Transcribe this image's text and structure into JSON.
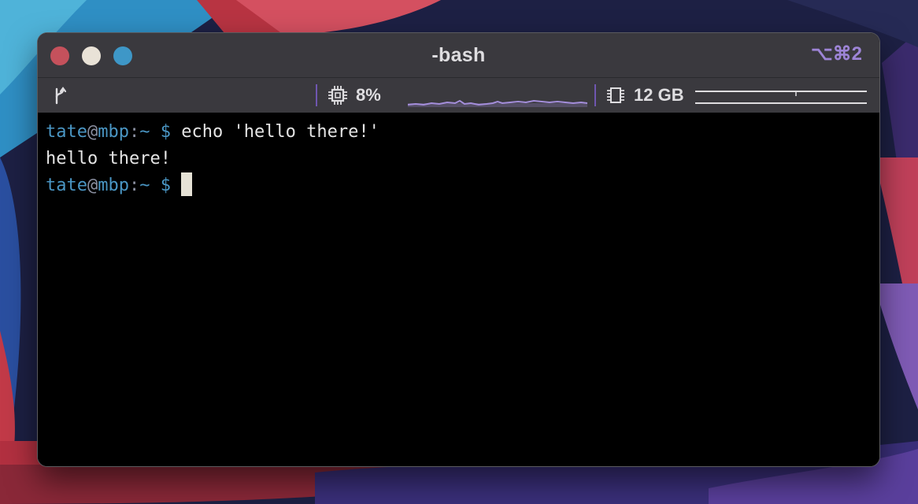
{
  "window": {
    "title": "-bash",
    "shortcut": "⌥⌘2"
  },
  "status": {
    "cpu_percent": "8%",
    "memory": "12 GB"
  },
  "terminal": {
    "lines": [
      {
        "user": "tate",
        "at": "@",
        "host": "mbp",
        "colon": ":",
        "cwd": "~",
        "dollar": "$",
        "command": " echo 'hello there!'"
      },
      {
        "output": "hello there!"
      },
      {
        "user": "tate",
        "at": "@",
        "host": "mbp",
        "colon": ":",
        "cwd": "~",
        "dollar": "$",
        "command": " "
      }
    ]
  },
  "colors": {
    "prompt": "#4a96c4",
    "accent": "#9d84d6",
    "close": "#c5515c",
    "minimize": "#e9e2d7",
    "maximize": "#3e97c7"
  },
  "icons": [
    "git-branch-icon",
    "cpu-icon",
    "memory-icon"
  ]
}
